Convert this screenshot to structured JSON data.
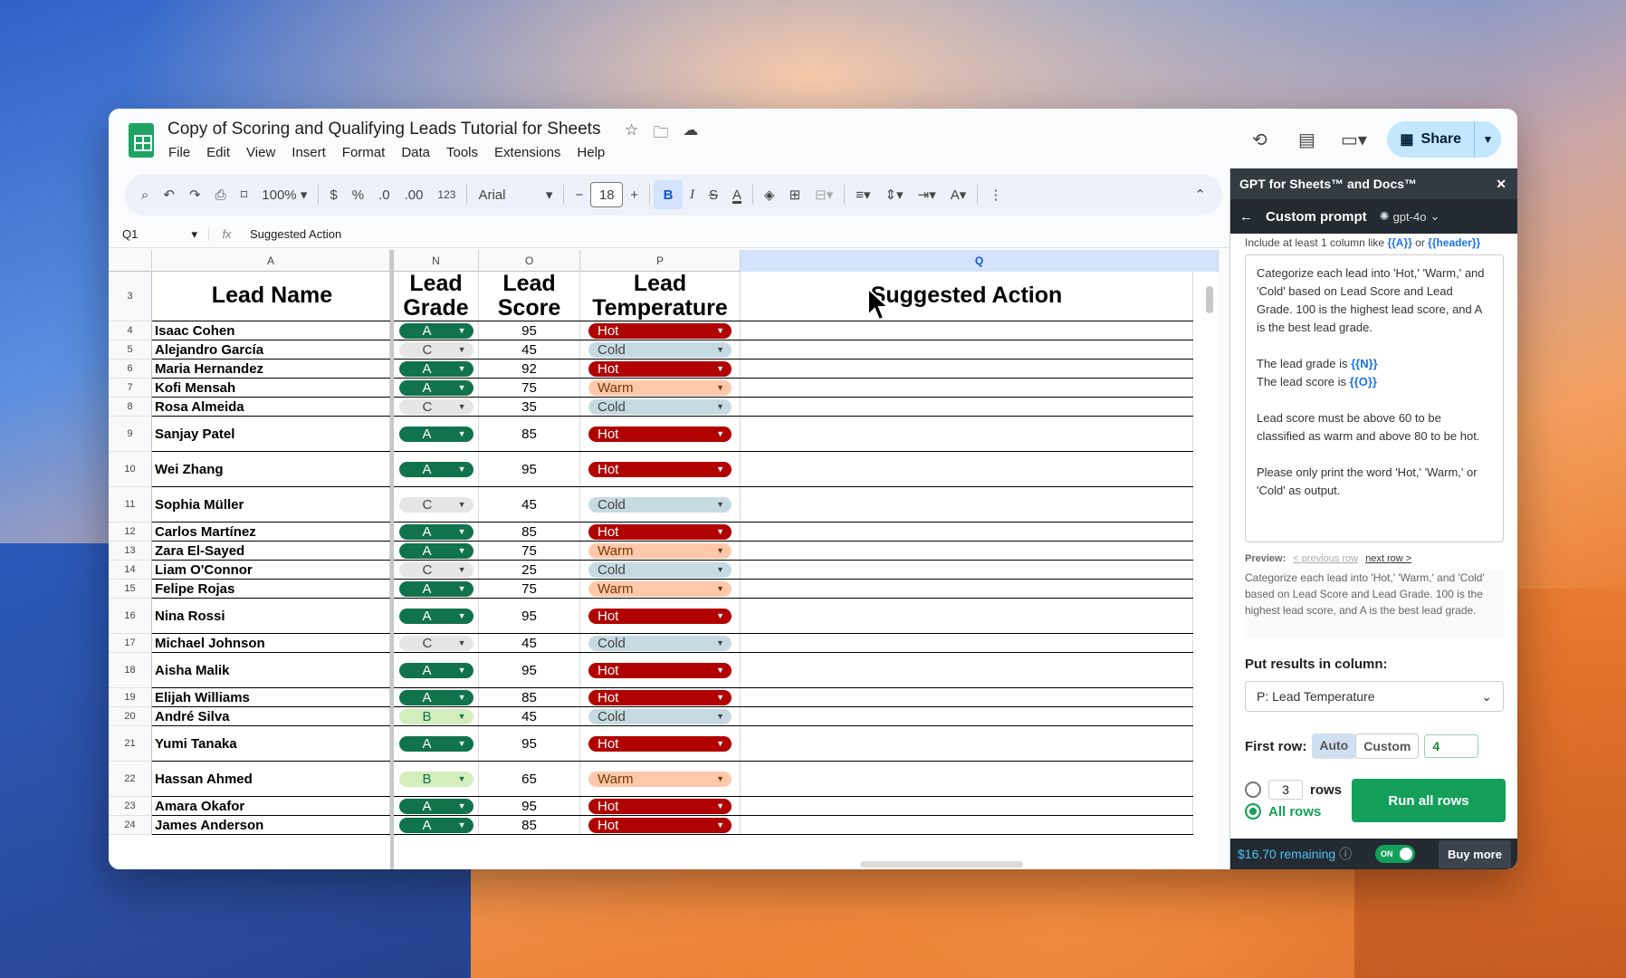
{
  "doc": {
    "title": "Copy of Scoring and Qualifying Leads Tutorial for Sheets",
    "menus": [
      "File",
      "Edit",
      "View",
      "Insert",
      "Format",
      "Data",
      "Tools",
      "Extensions",
      "Help"
    ],
    "share_label": "Share"
  },
  "toolbar": {
    "zoom": "100%",
    "currency": "$",
    "percent": "%",
    "dec_minus": ".0",
    "dec_plus": ".00",
    "number_format": "123",
    "font": "Arial",
    "font_size": "18",
    "minus": "−",
    "plus": "+",
    "bold": "B",
    "italic": "I",
    "strike": "S",
    "text_color": "A"
  },
  "formula_bar": {
    "cell_ref": "Q1",
    "content": "Suggested Action"
  },
  "sheet": {
    "columns": [
      "A",
      "N",
      "O",
      "P",
      "Q"
    ],
    "header_row": {
      "row_num": "3",
      "name": "Lead Name",
      "grade": "Lead Grade",
      "score": "Lead Score",
      "temp": "Lead Temperature",
      "action": "Suggested Action"
    },
    "rows": [
      {
        "num": "4",
        "name": "Isaac Cohen",
        "grade": "A",
        "score": "95",
        "temp": "Hot"
      },
      {
        "num": "5",
        "name": "Alejandro García",
        "grade": "C",
        "score": "45",
        "temp": "Cold"
      },
      {
        "num": "6",
        "name": "Maria Hernandez",
        "grade": "A",
        "score": "92",
        "temp": "Hot"
      },
      {
        "num": "7",
        "name": "Kofi Mensah",
        "grade": "A",
        "score": "75",
        "temp": "Warm"
      },
      {
        "num": "8",
        "name": "Rosa Almeida",
        "grade": "C",
        "score": "35",
        "temp": "Cold"
      },
      {
        "num": "9",
        "name": "Sanjay Patel",
        "grade": "A",
        "score": "85",
        "temp": "Hot"
      },
      {
        "num": "10",
        "name": "Wei Zhang",
        "grade": "A",
        "score": "95",
        "temp": "Hot"
      },
      {
        "num": "11",
        "name": "Sophia Müller",
        "grade": "C",
        "score": "45",
        "temp": "Cold"
      },
      {
        "num": "12",
        "name": "Carlos Martínez",
        "grade": "A",
        "score": "85",
        "temp": "Hot"
      },
      {
        "num": "13",
        "name": "Zara El-Sayed",
        "grade": "A",
        "score": "75",
        "temp": "Warm"
      },
      {
        "num": "14",
        "name": "Liam O'Connor",
        "grade": "C",
        "score": "25",
        "temp": "Cold"
      },
      {
        "num": "15",
        "name": "Felipe Rojas",
        "grade": "A",
        "score": "75",
        "temp": "Warm"
      },
      {
        "num": "16",
        "name": "Nina Rossi",
        "grade": "A",
        "score": "95",
        "temp": "Hot"
      },
      {
        "num": "17",
        "name": "Michael Johnson",
        "grade": "C",
        "score": "45",
        "temp": "Cold"
      },
      {
        "num": "18",
        "name": "Aisha Malik",
        "grade": "A",
        "score": "95",
        "temp": "Hot"
      },
      {
        "num": "19",
        "name": "Elijah Williams",
        "grade": "A",
        "score": "85",
        "temp": "Hot"
      },
      {
        "num": "20",
        "name": "André Silva",
        "grade": "B",
        "score": "45",
        "temp": "Cold"
      },
      {
        "num": "21",
        "name": "Yumi Tanaka",
        "grade": "A",
        "score": "95",
        "temp": "Hot"
      },
      {
        "num": "22",
        "name": "Hassan Ahmed",
        "grade": "B",
        "score": "65",
        "temp": "Warm"
      },
      {
        "num": "23",
        "name": "Amara Okafor",
        "grade": "A",
        "score": "95",
        "temp": "Hot"
      },
      {
        "num": "24",
        "name": "James Anderson",
        "grade": "A",
        "score": "85",
        "temp": "Hot"
      }
    ]
  },
  "panel": {
    "title": "GPT for Sheets™ and Docs™",
    "subtitle": "Custom prompt",
    "model": "gpt-4o",
    "hint_prefix": "Include at least 1 column like",
    "hint_a": "{{A}}",
    "hint_or": "or",
    "hint_header": "{{header}}",
    "prompt_p1": "Categorize each lead into 'Hot,' 'Warm,' and 'Cold' based on Lead Score and Lead Grade. 100 is the highest lead score, and A is the best lead grade.",
    "prompt_grade": "The lead grade is",
    "prompt_grade_var": "{{N}}",
    "prompt_score": "The lead score is",
    "prompt_score_var": "{{O}}",
    "prompt_p3": "Lead score must be above 60 to be classified as warm and above 80 to be hot.",
    "prompt_p4": "Please only print the word 'Hot,' 'Warm,' or 'Cold' as output.",
    "preview_label": "Preview:",
    "prev_row": "< previous row",
    "next_row": "next row >",
    "preview_text": "Categorize each lead into 'Hot,' 'Warm,' and 'Cold' based on Lead Score and Lead Grade. 100 is the highest lead score, and A is the best lead grade.",
    "put_label": "Put results in column:",
    "put_value": "P: Lead Temperature",
    "first_row_label": "First row:",
    "auto": "Auto",
    "custom": "Custom",
    "first_row_value": "4",
    "rows_count": "3",
    "rows_label": "rows",
    "all_rows": "All rows",
    "run_button": "Run all rows",
    "remaining": "$16.70 remaining",
    "toggle": "ON",
    "buy_more": "Buy more"
  }
}
